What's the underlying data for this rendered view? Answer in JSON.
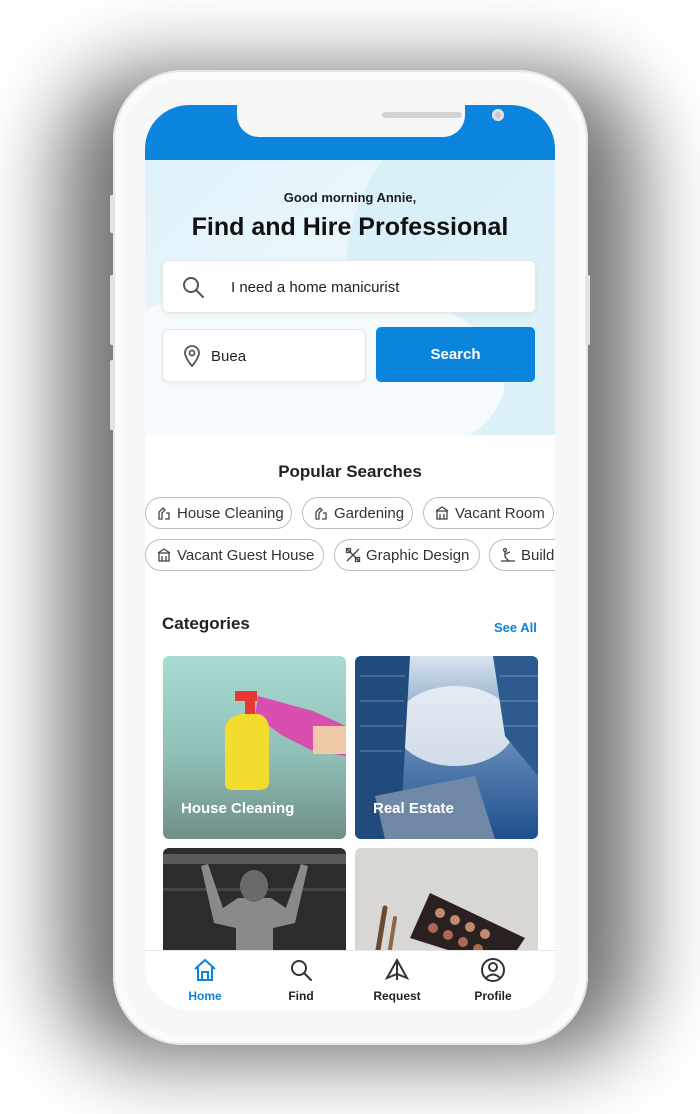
{
  "colors": {
    "primary": "#0b84dd",
    "text": "#222222",
    "chip_border": "#bdbdbd"
  },
  "header": {
    "greeting": "Good morning Annie,",
    "title": "Find and Hire Professional"
  },
  "search": {
    "query_value": "I need a home manicurist",
    "location_value": "Buea",
    "button_label": "Search",
    "search_icon": "search-icon",
    "location_icon": "location-pin-icon"
  },
  "popular": {
    "title": "Popular Searches",
    "row1": [
      {
        "label": "House Cleaning",
        "icon": "cleaning-icon"
      },
      {
        "label": "Gardening",
        "icon": "gardening-icon"
      },
      {
        "label": "Vacant Room",
        "icon": "building-icon"
      }
    ],
    "row2": [
      {
        "label": "Vacant Guest House",
        "icon": "building-icon"
      },
      {
        "label": "Graphic Design",
        "icon": "design-icon"
      },
      {
        "label": "Build",
        "icon": "construction-icon"
      }
    ]
  },
  "categories": {
    "title": "Categories",
    "see_all": "See All",
    "items": [
      {
        "label": "House Cleaning"
      },
      {
        "label": "Real Estate"
      },
      {
        "label": ""
      },
      {
        "label": ""
      }
    ]
  },
  "nav": {
    "items": [
      {
        "label": "Home",
        "icon": "home-icon",
        "active": true
      },
      {
        "label": "Find",
        "icon": "search-icon",
        "active": false
      },
      {
        "label": "Request",
        "icon": "request-icon",
        "active": false
      },
      {
        "label": "Profile",
        "icon": "profile-icon",
        "active": false
      }
    ]
  }
}
